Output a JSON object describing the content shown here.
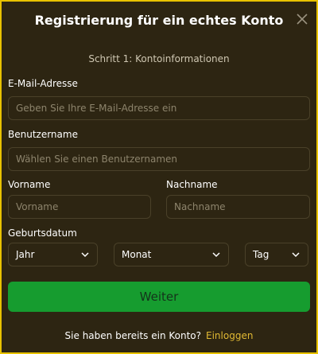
{
  "modal": {
    "title": "Registrierung für ein echtes Konto",
    "step": "Schritt 1: Kontoinformationen"
  },
  "form": {
    "email_label": "E-Mail-Adresse",
    "email_placeholder": "Geben Sie Ihre E-Mail-Adresse ein",
    "username_label": "Benutzername",
    "username_placeholder": "Wählen Sie einen Benutzernamen",
    "firstname_label": "Vorname",
    "firstname_placeholder": "Vorname",
    "lastname_label": "Nachname",
    "lastname_placeholder": "Nachname",
    "birthdate_label": "Geburtsdatum",
    "year_value": "Jahr",
    "month_value": "Monat",
    "day_value": "Tag"
  },
  "actions": {
    "next_label": "Weiter"
  },
  "footer": {
    "question": "Sie haben bereits ein Konto?",
    "login_label": "Einloggen"
  },
  "colors": {
    "background": "#2d2512",
    "accent": "#169c2f",
    "link": "#e1b933",
    "frame": "#e8c200"
  },
  "icons": {
    "close": "close-icon",
    "dropdown": "chevron-down-icon"
  }
}
